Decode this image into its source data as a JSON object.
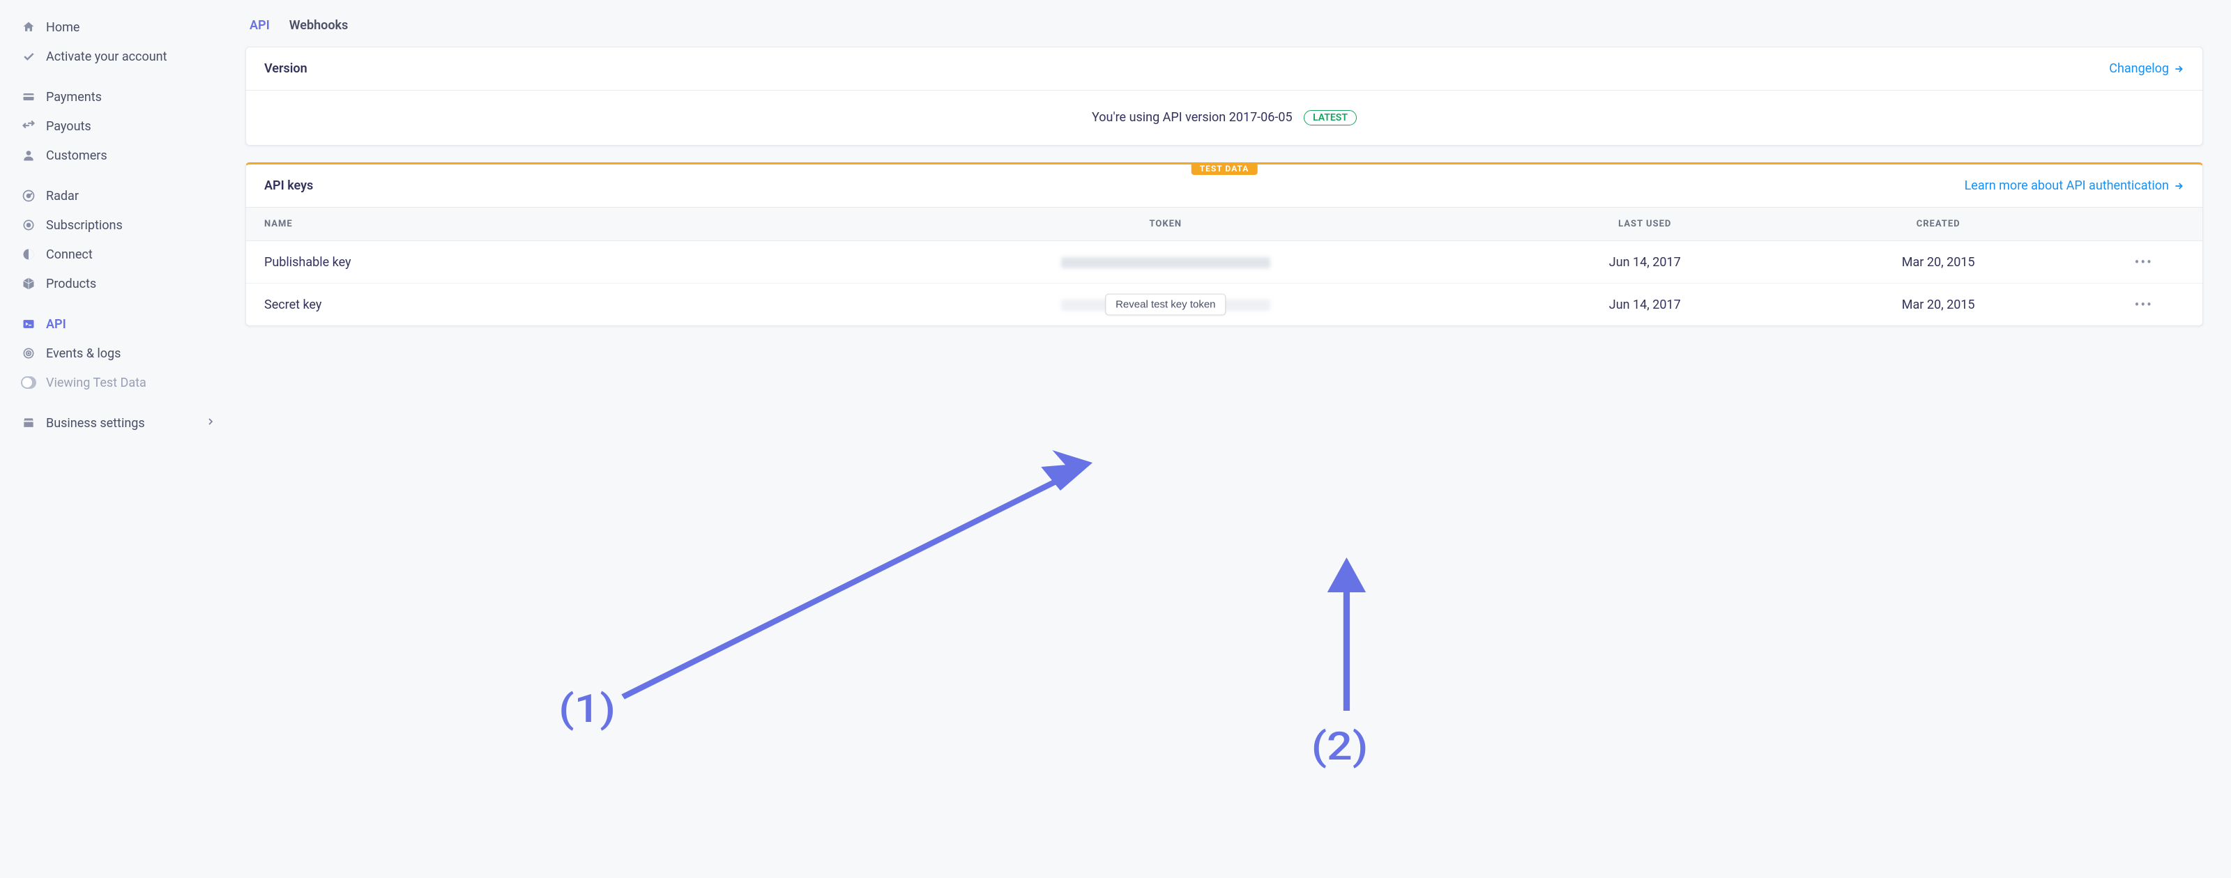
{
  "sidebar": {
    "groups": [
      [
        {
          "label": "Home"
        },
        {
          "label": "Activate your account"
        }
      ],
      [
        {
          "label": "Payments"
        },
        {
          "label": "Payouts"
        },
        {
          "label": "Customers"
        }
      ],
      [
        {
          "label": "Radar"
        },
        {
          "label": "Subscriptions"
        },
        {
          "label": "Connect"
        },
        {
          "label": "Products"
        }
      ],
      [
        {
          "label": "API",
          "active": true
        },
        {
          "label": "Events & logs"
        },
        {
          "label": "Viewing Test Data",
          "faded": true,
          "toggle": true
        }
      ],
      [
        {
          "label": "Business settings",
          "chevron": true
        }
      ]
    ]
  },
  "tabs": {
    "api": "API",
    "webhooks": "Webhooks"
  },
  "version_card": {
    "title": "Version",
    "changelog": "Changelog",
    "body_prefix": "You're using API version ",
    "api_version": "2017-06-05",
    "badge": "LATEST"
  },
  "keys_card": {
    "title": "API keys",
    "learn_link": "Learn more about API authentication",
    "test_flag": "TEST DATA",
    "headers": {
      "name": "NAME",
      "token": "TOKEN",
      "last_used": "LAST USED",
      "created": "CREATED"
    },
    "rows": [
      {
        "name": "Publishable key",
        "last_used": "Jun 14, 2017",
        "created": "Mar 20, 2015"
      },
      {
        "name": "Secret key",
        "last_used": "Jun 14, 2017",
        "created": "Mar 20, 2015"
      }
    ],
    "reveal_button": "Reveal test key token"
  },
  "annotations": {
    "one": "(1)",
    "two": "(2)"
  }
}
